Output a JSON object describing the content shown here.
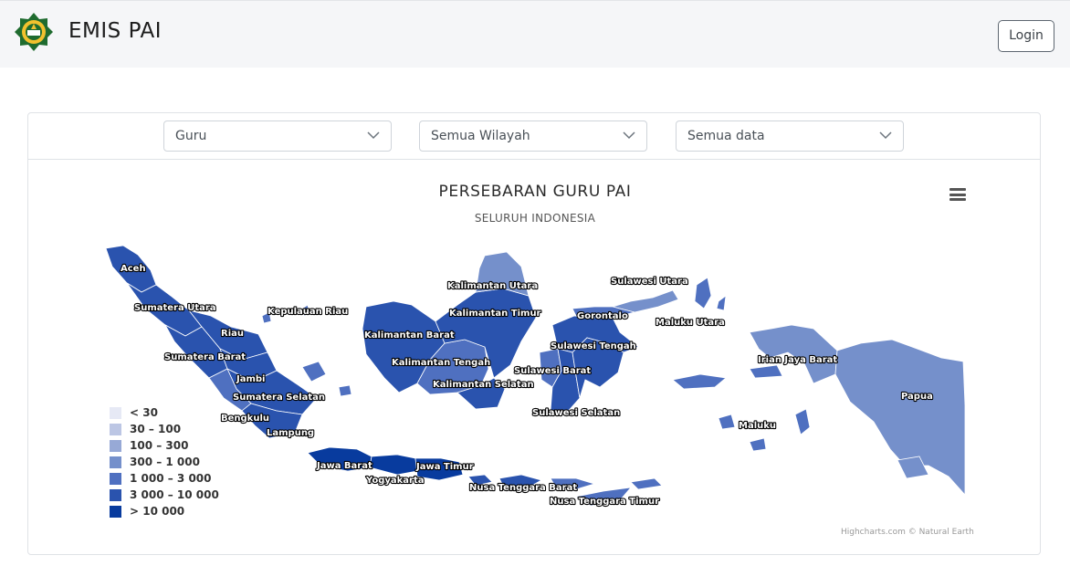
{
  "header": {
    "title": "EMIS PAI",
    "login_label": "Login",
    "logo_icon": "kemenag-emblem-icon"
  },
  "filters": [
    {
      "value": "Guru"
    },
    {
      "value": "Semua Wilayah"
    },
    {
      "value": "Semua data"
    }
  ],
  "chart": {
    "title": "PERSEBARAN GURU PAI",
    "subtitle": "SELURUH INDONESIA",
    "credits": "Highcharts.com © Natural Earth",
    "menu_icon": "hamburger-menu-icon"
  },
  "legend": [
    {
      "label": "< 30",
      "color": "#e6e9f5"
    },
    {
      "label": "30 – 100",
      "color": "#bcc6e4"
    },
    {
      "label": "100 – 300",
      "color": "#97a9d6"
    },
    {
      "label": "300 – 1 000",
      "color": "#7590cb"
    },
    {
      "label": "1 000 – 3 000",
      "color": "#4f70c0"
    },
    {
      "label": "3 000 – 10 000",
      "color": "#2a53ae"
    },
    {
      "label": "> 10 000",
      "color": "#083b9e"
    }
  ],
  "chart_data": {
    "type": "map",
    "title": "PERSEBARAN GURU PAI",
    "subtitle": "SELURUH INDONESIA",
    "color_classes": [
      "< 30",
      "30 – 100",
      "100 – 300",
      "300 – 1 000",
      "1 000 – 3 000",
      "3 000 – 10 000",
      "> 10 000"
    ],
    "regions": [
      {
        "name": "Aceh",
        "class": "3 000 – 10 000"
      },
      {
        "name": "Sumatera Utara",
        "class": "3 000 – 10 000"
      },
      {
        "name": "Riau",
        "class": "3 000 – 10 000"
      },
      {
        "name": "Kepulauan Riau",
        "class": "1 000 – 3 000"
      },
      {
        "name": "Sumatera Barat",
        "class": "3 000 – 10 000"
      },
      {
        "name": "Jambi",
        "class": "3 000 – 10 000"
      },
      {
        "name": "Sumatera Selatan",
        "class": "3 000 – 10 000"
      },
      {
        "name": "Bengkulu",
        "class": "1 000 – 3 000"
      },
      {
        "name": "Lampung",
        "class": "3 000 – 10 000"
      },
      {
        "name": "Jawa Barat",
        "class": "> 10 000"
      },
      {
        "name": "Yogyakarta",
        "class": "3 000 – 10 000"
      },
      {
        "name": "Jawa Timur",
        "class": "> 10 000"
      },
      {
        "name": "Kalimantan Barat",
        "class": "3 000 – 10 000"
      },
      {
        "name": "Kalimantan Tengah",
        "class": "1 000 – 3 000"
      },
      {
        "name": "Kalimantan Selatan",
        "class": "3 000 – 10 000"
      },
      {
        "name": "Kalimantan Timur",
        "class": "3 000 – 10 000"
      },
      {
        "name": "Kalimantan Utara",
        "class": "300 – 1 000"
      },
      {
        "name": "Sulawesi Utara",
        "class": "300 – 1 000"
      },
      {
        "name": "Gorontalo",
        "class": "1 000 – 3 000"
      },
      {
        "name": "Sulawesi Tengah",
        "class": "3 000 – 10 000"
      },
      {
        "name": "Sulawesi Barat",
        "class": "1 000 – 3 000"
      },
      {
        "name": "Sulawesi Selatan",
        "class": "3 000 – 10 000"
      },
      {
        "name": "Maluku Utara",
        "class": "1 000 – 3 000"
      },
      {
        "name": "Maluku",
        "class": "1 000 – 3 000"
      },
      {
        "name": "Irian Jaya Barat",
        "class": "300 – 1 000"
      },
      {
        "name": "Papua",
        "class": "300 – 1 000"
      },
      {
        "name": "Nusa Tenggara Barat",
        "class": "3 000 – 10 000"
      },
      {
        "name": "Nusa Tenggara Timur",
        "class": "1 000 – 3 000"
      }
    ]
  }
}
